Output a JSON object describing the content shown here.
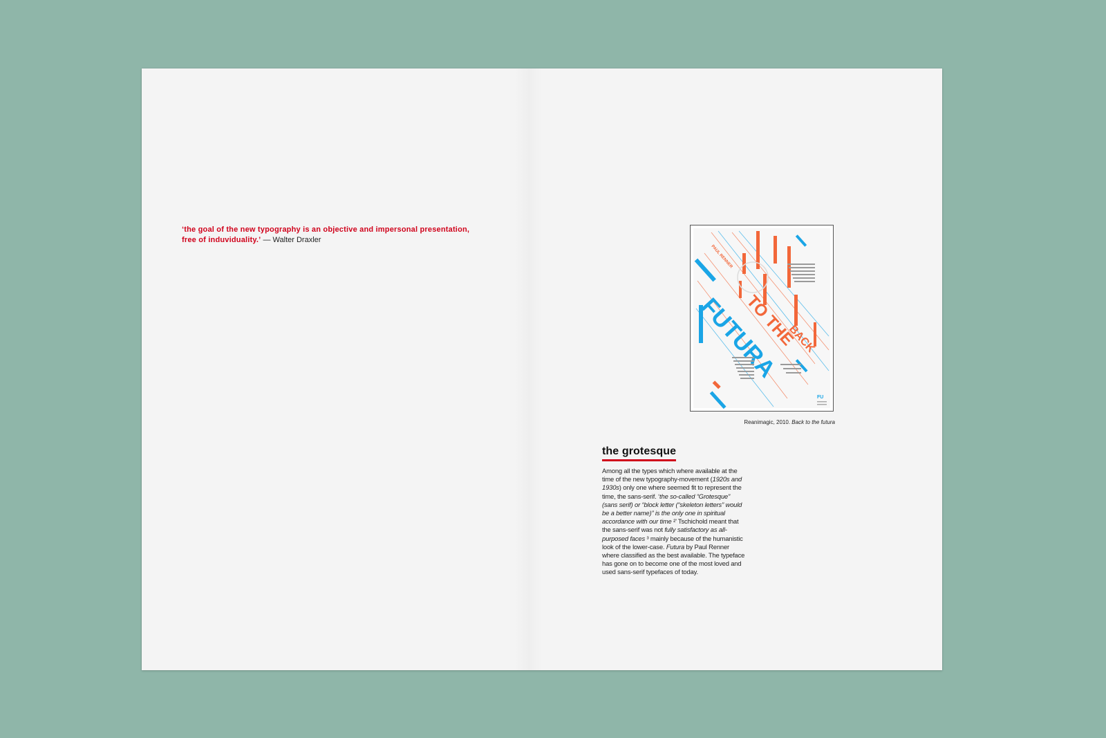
{
  "quote": {
    "text": "‘the goal of the new typography is an objective and impersonal presentation, free of induviduality.’",
    "author": "— Walter Draxler"
  },
  "poster": {
    "title_back": "BACK",
    "title_to_the": "TO THE",
    "title_futura": "FUTURA",
    "name_tag": "PAUL RENNER",
    "logo": "FU",
    "colors": {
      "blue": "#1aa5e6",
      "orange": "#f2673a",
      "red": "#d0021b"
    }
  },
  "caption": {
    "prefix": "Reanimagic, 2010.",
    "title": "Back to the futura"
  },
  "section": {
    "heading": "the grotesque",
    "body": [
      {
        "t": "Among all the types which where available at the time of the new typography-movement (",
        "i": false
      },
      {
        "t": "1920s and 1930s",
        "i": true
      },
      {
        "t": ")  only one where seemed fit to represent the time, the sans-serif. ‘",
        "i": false
      },
      {
        "t": "the so-called “Grotesque” (sans serif) or “block letter (“skeleton letters” would be a better name)” is the only one in spiritual accordance with our time",
        "i": true
      },
      {
        "t": " ²’ Tschichold meant that the sans-serif was not ",
        "i": false
      },
      {
        "t": "fully satisfactory as all-purposed faces",
        "i": true
      },
      {
        "t": " ³ mainly because of the humanistic look of the lower-case. ",
        "i": false
      },
      {
        "t": "Futura",
        "i": true
      },
      {
        "t": " by Paul Renner where classified as the best available. The typeface has gone on to become one of the most loved and used sans-serif typefaces of today.",
        "i": false
      }
    ]
  }
}
